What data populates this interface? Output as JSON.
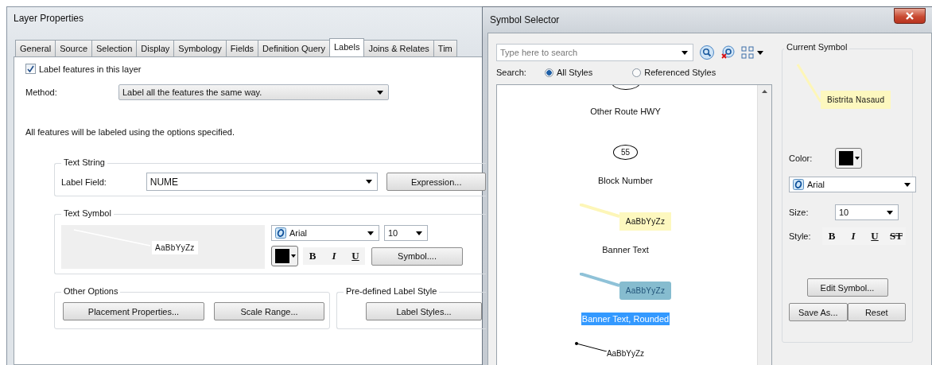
{
  "layer_properties": {
    "title": "Layer Properties",
    "tabs": [
      {
        "label": "General",
        "selected": false
      },
      {
        "label": "Source",
        "selected": false
      },
      {
        "label": "Selection",
        "selected": false
      },
      {
        "label": "Display",
        "selected": false
      },
      {
        "label": "Symbology",
        "selected": false
      },
      {
        "label": "Fields",
        "selected": false
      },
      {
        "label": "Definition Query",
        "selected": false
      },
      {
        "label": "Labels",
        "selected": true
      },
      {
        "label": "Joins & Relates",
        "selected": false
      },
      {
        "label": "Tim",
        "selected": false
      }
    ],
    "label_features": {
      "label": "Label features in this layer",
      "checked": true
    },
    "method": {
      "label": "Method:",
      "value": "Label all the features the same way."
    },
    "info": "All features will be labeled using the options specified.",
    "text_string": {
      "title": "Text String",
      "field_label": "Label Field:",
      "field_value": "NUME",
      "button": "Expression..."
    },
    "text_symbol": {
      "title": "Text Symbol",
      "preview": "AaBbYyZz",
      "font": "Arial",
      "size": "10",
      "styles": [
        {
          "label": "B",
          "kind": "bold"
        },
        {
          "label": "I",
          "kind": "italic"
        },
        {
          "label": "U",
          "kind": "underline"
        }
      ],
      "button": "Symbol...."
    },
    "other_options": {
      "title": "Other Options",
      "buttons": [
        "Placement Properties...",
        "Scale Range..."
      ]
    },
    "predefined_style": {
      "title": "Pre-defined Label Style",
      "button": "Label Styles..."
    }
  },
  "symbol_selector": {
    "title": "Symbol Selector",
    "search": {
      "placeholder": "Type here to search"
    },
    "search_label": "Search:",
    "scopes": [
      {
        "label": "All Styles",
        "selected": true
      },
      {
        "label": "Referenced Styles",
        "selected": false
      }
    ],
    "symbols": [
      {
        "kind": "oval",
        "name": "Other Route HWY",
        "selected": false
      },
      {
        "kind": "oval",
        "sample": "55",
        "name": "Block Number",
        "selected": false
      },
      {
        "kind": "banner",
        "sample": "AaBbYyZz",
        "name": "Banner Text",
        "selected": false
      },
      {
        "kind": "banner-rounded",
        "sample": "AaBbYyZz",
        "name": "Banner Text, Rounded",
        "selected": true
      },
      {
        "kind": "leader",
        "sample": "AaBbYyZz"
      }
    ],
    "current_symbol": {
      "title": "Current Symbol",
      "preview": "Bistrita Nasaud",
      "color_label": "Color:",
      "font": "Arial",
      "size_label": "Size:",
      "size": "10",
      "style_label": "Style:",
      "styles": [
        {
          "label": "B",
          "kind": "bold"
        },
        {
          "label": "I",
          "kind": "italic"
        },
        {
          "label": "U",
          "kind": "underline"
        },
        {
          "label": "ST",
          "kind": "strike"
        }
      ],
      "edit_button": "Edit Symbol...",
      "save_button": "Save As...",
      "reset_button": "Reset"
    }
  }
}
